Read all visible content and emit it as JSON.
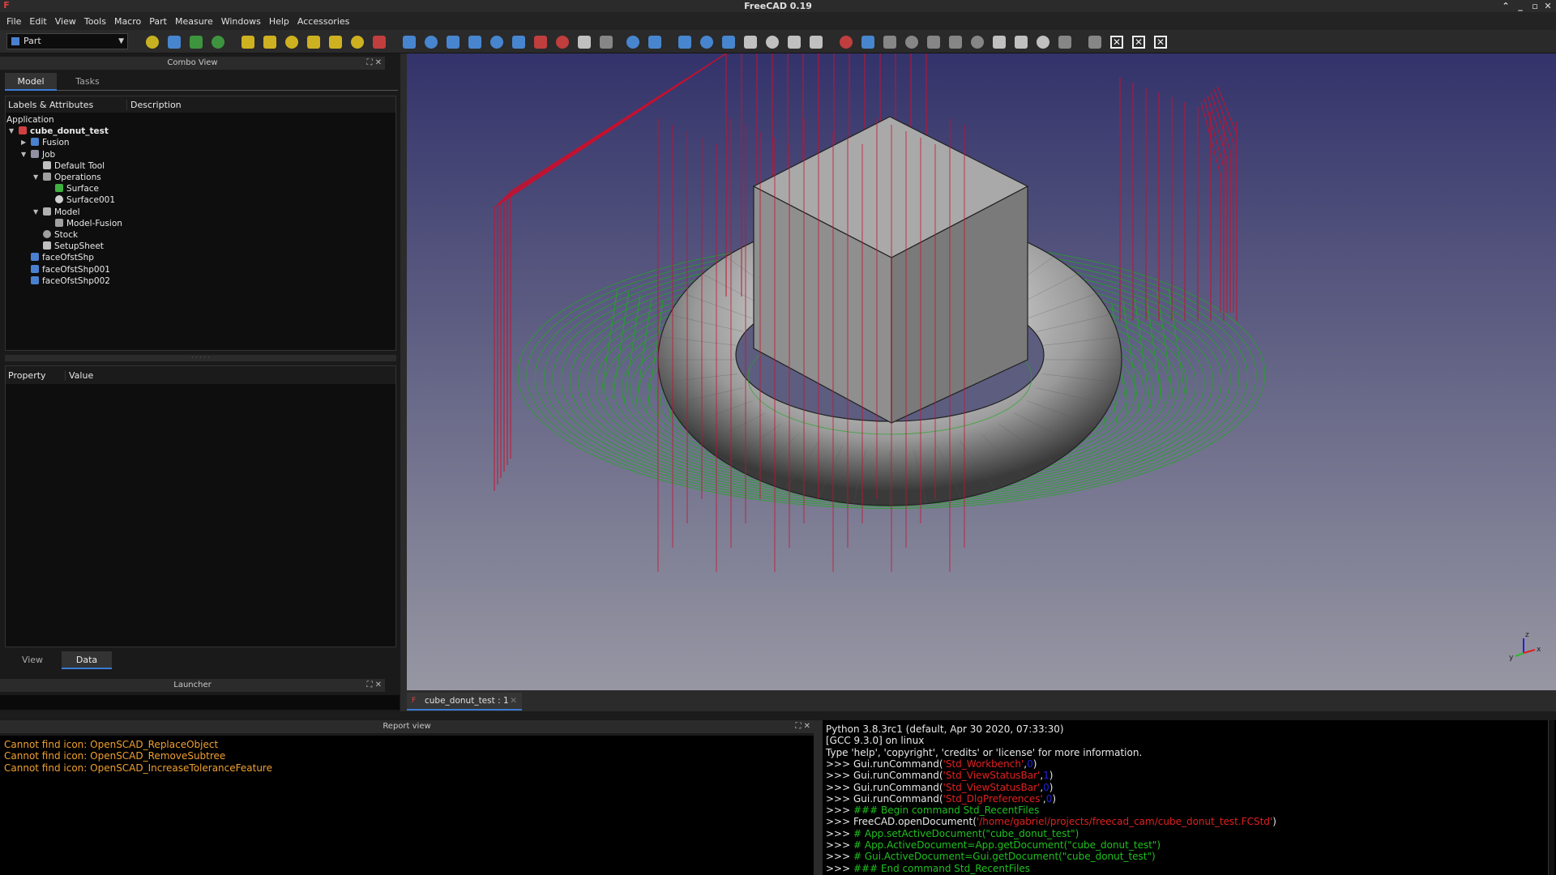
{
  "window": {
    "title": "FreeCAD 0.19"
  },
  "menubar": [
    "File",
    "Edit",
    "View",
    "Tools",
    "Macro",
    "Part",
    "Measure",
    "Windows",
    "Help",
    "Accessories"
  ],
  "workbench": {
    "selected": "Part"
  },
  "toolbar_icons": [
    {
      "name": "sketch-icon",
      "color": "#d8c020"
    },
    {
      "name": "open-icon",
      "color": "#4a90e0"
    },
    {
      "name": "undo-icon",
      "color": "#40a040"
    },
    {
      "name": "redo-icon",
      "color": "#40a040"
    },
    {
      "name": "box-icon",
      "color": "#e0c020"
    },
    {
      "name": "cylinder-icon",
      "color": "#e0c020"
    },
    {
      "name": "sphere-icon",
      "color": "#e0c020"
    },
    {
      "name": "cone-icon",
      "color": "#e0c020"
    },
    {
      "name": "torus-icon",
      "color": "#e0c020"
    },
    {
      "name": "primitives-icon",
      "color": "#e0c020"
    },
    {
      "name": "shape-builder-icon",
      "color": "#d04040"
    },
    {
      "name": "extrude-icon",
      "color": "#4a90e0"
    },
    {
      "name": "revolve-icon",
      "color": "#4a90e0"
    },
    {
      "name": "mirror-icon",
      "color": "#4a90e0"
    },
    {
      "name": "fillet-icon",
      "color": "#4a90e0"
    },
    {
      "name": "chamfer-icon",
      "color": "#4a90e0"
    },
    {
      "name": "make-face-icon",
      "color": "#4a90e0"
    },
    {
      "name": "ruled-surface-icon",
      "color": "#d04040"
    },
    {
      "name": "loft-icon",
      "color": "#d04040"
    },
    {
      "name": "sweep-icon",
      "color": "#d0d0d0"
    },
    {
      "name": "section-icon",
      "color": "#909090"
    },
    {
      "name": "cross-sections-icon",
      "color": "#4a90e0"
    },
    {
      "name": "offset-icon",
      "color": "#4a90e0"
    },
    {
      "name": "thickness-icon",
      "color": "#4a90e0"
    },
    {
      "name": "projection-icon",
      "color": "#4a90e0"
    },
    {
      "name": "compound-icon",
      "color": "#4a90e0"
    },
    {
      "name": "boolean-icon",
      "color": "#d0d0d0"
    },
    {
      "name": "cut-icon",
      "color": "#d0d0d0"
    },
    {
      "name": "fuse-icon",
      "color": "#d0d0d0"
    },
    {
      "name": "common-icon",
      "color": "#d0d0d0"
    },
    {
      "name": "join-icon",
      "color": "#d04040"
    },
    {
      "name": "split-icon",
      "color": "#4a90e0"
    },
    {
      "name": "check-geometry-icon",
      "color": "#909090"
    },
    {
      "name": "defeaturing-icon",
      "color": "#909090"
    },
    {
      "name": "measure-linear-icon",
      "color": "#909090"
    },
    {
      "name": "measure-angular-icon",
      "color": "#909090"
    },
    {
      "name": "measure-refresh-icon",
      "color": "#909090"
    },
    {
      "name": "measure-clear-icon",
      "color": "#d0d0d0"
    },
    {
      "name": "measure-toggle-icon",
      "color": "#d0d0d0"
    },
    {
      "name": "measure-toggle-3d-icon",
      "color": "#d0d0d0"
    },
    {
      "name": "measure-toggle-delta-icon",
      "color": "#909090"
    },
    {
      "name": "measure-label-icon",
      "color": "#909090"
    },
    {
      "name": "close-x-icon",
      "color": "#f0f0f0"
    },
    {
      "name": "close-x-icon",
      "color": "#f0f0f0"
    },
    {
      "name": "close-x-icon",
      "color": "#f0f0f0"
    }
  ],
  "combo_view": {
    "title": "Combo View",
    "tabs": [
      "Model",
      "Tasks"
    ],
    "tree_header": [
      "Labels & Attributes",
      "Description"
    ],
    "tree": [
      {
        "label": "Application",
        "depth": -1,
        "icon": "none",
        "arrow": "",
        "bold": false
      },
      {
        "label": "cube_donut_test",
        "depth": 0,
        "icon": "document",
        "arrow": "down",
        "bold": true
      },
      {
        "label": "Fusion",
        "depth": 1,
        "icon": "part",
        "arrow": "right",
        "bold": false
      },
      {
        "label": "Job",
        "depth": 1,
        "icon": "job",
        "arrow": "down",
        "bold": false
      },
      {
        "label": "Default Tool",
        "depth": 2,
        "icon": "tool",
        "arrow": "",
        "bold": false
      },
      {
        "label": "Operations",
        "depth": 2,
        "icon": "ops",
        "arrow": "down",
        "bold": false
      },
      {
        "label": "Surface",
        "depth": 3,
        "icon": "surface",
        "arrow": "",
        "bold": false
      },
      {
        "label": "Surface001",
        "depth": 3,
        "icon": "surface2",
        "arrow": "",
        "bold": false
      },
      {
        "label": "Model",
        "depth": 2,
        "icon": "folder",
        "arrow": "down",
        "bold": false
      },
      {
        "label": "Model-Fusion",
        "depth": 3,
        "icon": "clone",
        "arrow": "",
        "bold": false
      },
      {
        "label": "Stock",
        "depth": 2,
        "icon": "stock",
        "arrow": "",
        "bold": false
      },
      {
        "label": "SetupSheet",
        "depth": 2,
        "icon": "sheet",
        "arrow": "",
        "bold": false
      },
      {
        "label": "faceOfstShp",
        "depth": 1,
        "icon": "face",
        "arrow": "",
        "bold": false
      },
      {
        "label": "faceOfstShp001",
        "depth": 1,
        "icon": "face",
        "arrow": "",
        "bold": false
      },
      {
        "label": "faceOfstShp002",
        "depth": 1,
        "icon": "face",
        "arrow": "",
        "bold": false
      }
    ],
    "property_header": [
      "Property",
      "Value"
    ],
    "view_data_tabs": [
      "View",
      "Data"
    ]
  },
  "launcher": {
    "title": "Launcher"
  },
  "document_tab": {
    "label": "cube_donut_test : 1"
  },
  "report_view": {
    "title": "Report view",
    "lines": [
      "Cannot find icon: OpenSCAD_ReplaceObject",
      "Cannot find icon: OpenSCAD_RemoveSubtree",
      "Cannot find icon: OpenSCAD_IncreaseToleranceFeature"
    ]
  },
  "python_console": {
    "lines": [
      [
        {
          "t": "Python 3.8.3rc1 (default, Apr 30 2020, 07:33:30)",
          "c": ""
        }
      ],
      [
        {
          "t": "[GCC 9.3.0] on linux",
          "c": ""
        }
      ],
      [
        {
          "t": "Type 'help', 'copyright', 'credits' or 'license' for more information.",
          "c": ""
        }
      ],
      [
        {
          "t": ">>> Gui.runCommand(",
          "c": ""
        },
        {
          "t": "'Std_Workbench'",
          "c": "str"
        },
        {
          "t": ",",
          "c": ""
        },
        {
          "t": "0",
          "c": "num"
        },
        {
          "t": ")",
          "c": ""
        }
      ],
      [
        {
          "t": ">>> Gui.runCommand(",
          "c": ""
        },
        {
          "t": "'Std_ViewStatusBar'",
          "c": "str"
        },
        {
          "t": ",",
          "c": ""
        },
        {
          "t": "1",
          "c": "num"
        },
        {
          "t": ")",
          "c": ""
        }
      ],
      [
        {
          "t": ">>> Gui.runCommand(",
          "c": ""
        },
        {
          "t": "'Std_ViewStatusBar'",
          "c": "str"
        },
        {
          "t": ",",
          "c": ""
        },
        {
          "t": "0",
          "c": "num"
        },
        {
          "t": ")",
          "c": ""
        }
      ],
      [
        {
          "t": ">>> Gui.runCommand(",
          "c": ""
        },
        {
          "t": "'Std_DlgPreferences'",
          "c": "str"
        },
        {
          "t": ",",
          "c": ""
        },
        {
          "t": "0",
          "c": "num"
        },
        {
          "t": ")",
          "c": ""
        }
      ],
      [
        {
          "t": ">>> ",
          "c": ""
        },
        {
          "t": "### Begin command Std_RecentFiles",
          "c": "cmt"
        }
      ],
      [
        {
          "t": ">>> FreeCAD.openDocument(",
          "c": ""
        },
        {
          "t": "'/home/gabriel/projects/freecad_cam/cube_donut_test.FCStd'",
          "c": "str"
        },
        {
          "t": ")",
          "c": ""
        }
      ],
      [
        {
          "t": ">>> ",
          "c": ""
        },
        {
          "t": "# App.setActiveDocument(\"cube_donut_test\")",
          "c": "cmt"
        }
      ],
      [
        {
          "t": ">>> ",
          "c": ""
        },
        {
          "t": "# App.ActiveDocument=App.getDocument(\"cube_donut_test\")",
          "c": "cmt"
        }
      ],
      [
        {
          "t": ">>> ",
          "c": ""
        },
        {
          "t": "# Gui.ActiveDocument=Gui.getDocument(\"cube_donut_test\")",
          "c": "cmt"
        }
      ],
      [
        {
          "t": ">>> ",
          "c": ""
        },
        {
          "t": "### End command Std_RecentFiles",
          "c": "cmt"
        }
      ]
    ]
  },
  "axis_labels": {
    "x": "x",
    "y": "y",
    "z": "z"
  },
  "colors": {
    "toolpath_red": "#c8102e",
    "toolpath_green": "#1fa81f",
    "viewport_top": "#33336b",
    "viewport_bottom": "#9797a3",
    "accent": "#3a7bd5"
  }
}
